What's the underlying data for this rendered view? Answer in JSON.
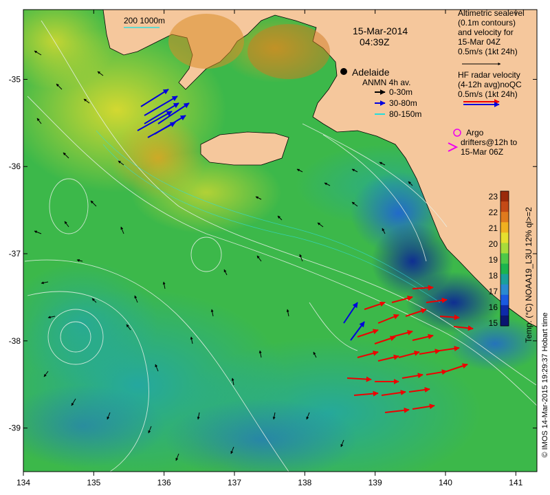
{
  "title": {
    "date": "15-Mar-2014",
    "time": "04:39Z"
  },
  "scale_bar": {
    "label": "200  1000m"
  },
  "place_label": "Adelaide",
  "legend_altimetry": {
    "lines": [
      "Altimetric sealevel",
      "(0.1m contours)",
      "and velocity for",
      "15-Mar 04Z",
      "0.5m/s (1kt 24h)"
    ]
  },
  "legend_hf_radar": {
    "lines": [
      "HF radar velocity",
      "(4-12h avg)noQC",
      "0.5m/s (1kt 24h)"
    ]
  },
  "legend_anmn": {
    "title": "ANMN 4h av.",
    "items": [
      {
        "label": "0-30m",
        "color": "#000000"
      },
      {
        "label": "30-80m",
        "color": "#0000dd"
      },
      {
        "label": "80-150m",
        "color": "#22dddd"
      }
    ]
  },
  "legend_argo": {
    "lines": [
      "Argo",
      "drifters@12h to",
      "15-Mar 06Z"
    ],
    "color": "#ee00ee"
  },
  "colorbar": {
    "ticks": [
      "23",
      "22",
      "21",
      "20",
      "19",
      "18",
      "17",
      "16",
      "15"
    ],
    "label": "Temp. (°C) NOAA19_L3U 12% ql>=2",
    "colors": [
      "#9a2a0a",
      "#c44a16",
      "#e07a1e",
      "#f0b020",
      "#e6df2e",
      "#a8dc3a",
      "#4ec848",
      "#1cb44e",
      "#1ba09a",
      "#2a8ad0",
      "#1a5ae0",
      "#0d2aa8",
      "#0a1670"
    ]
  },
  "axes": {
    "x_ticks": [
      "134",
      "135",
      "136",
      "137",
      "138",
      "139",
      "140",
      "141"
    ],
    "y_ticks": [
      "-35",
      "-36",
      "-37",
      "-38",
      "-39"
    ]
  },
  "credit": "© IMOS 14-Mar-2015 19:29:37 Hobart time",
  "colors": {
    "land": "#f5c79c",
    "hf_radar": "#ee0000",
    "altimetry_vector": "#000000"
  }
}
